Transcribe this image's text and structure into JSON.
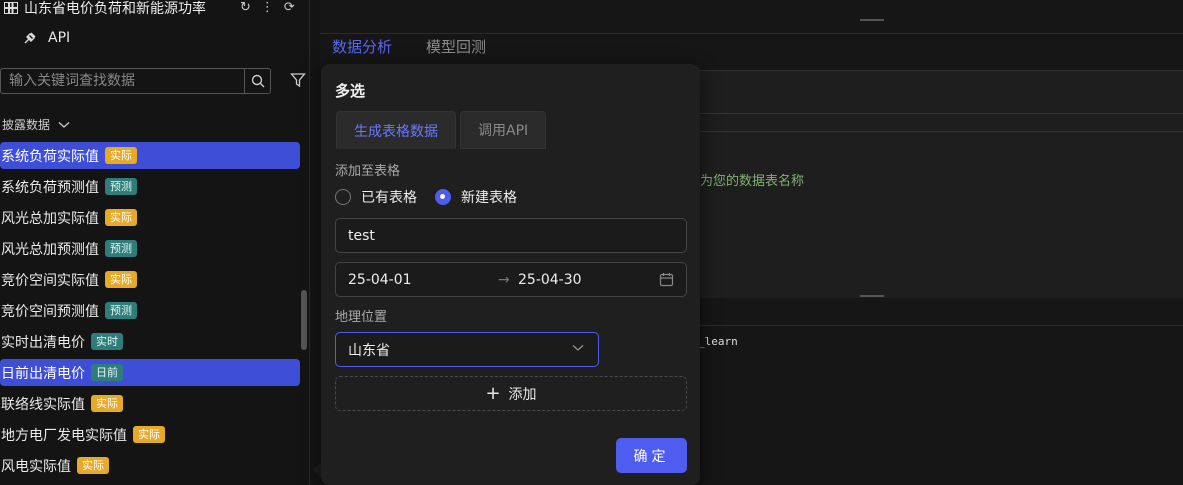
{
  "sidebar": {
    "title": "山东省电价负荷和新能源功率",
    "api_label": "API",
    "search": {
      "placeholder": "输入关键词查找数据",
      "value": ""
    },
    "section": "披露数据",
    "items": [
      {
        "label": "系统负荷实际值",
        "tag": "实际",
        "tag_type": "real",
        "active": true
      },
      {
        "label": "系统负荷预测值",
        "tag": "预测",
        "tag_type": "pred",
        "active": false
      },
      {
        "label": "风光总加实际值",
        "tag": "实际",
        "tag_type": "real",
        "active": false
      },
      {
        "label": "风光总加预测值",
        "tag": "预测",
        "tag_type": "pred",
        "active": false
      },
      {
        "label": "竞价空间实际值",
        "tag": "实际",
        "tag_type": "real",
        "active": false
      },
      {
        "label": "竞价空间预测值",
        "tag": "预测",
        "tag_type": "pred",
        "active": false
      },
      {
        "label": "实时出清电价",
        "tag": "实时",
        "tag_type": "rt",
        "active": false
      },
      {
        "label": "日前出清电价",
        "tag": "日前",
        "tag_type": "day",
        "active": true
      },
      {
        "label": "联络线实际值",
        "tag": "实际",
        "tag_type": "real",
        "active": false
      },
      {
        "label": "地方电厂发电实际值",
        "tag": "实际",
        "tag_type": "real",
        "active": false
      },
      {
        "label": "风电实际值",
        "tag": "实际",
        "tag_type": "real",
        "active": false
      }
    ]
  },
  "main": {
    "tabs": [
      "数据分析",
      "模型回测"
    ],
    "hint": "为您的数据表名称",
    "code_snippet": "_learn"
  },
  "popover": {
    "title": "多选",
    "tabs": [
      "生成表格数据",
      "调用API"
    ],
    "add_to_label": "添加至表格",
    "radio_existing": "已有表格",
    "radio_new": "新建表格",
    "table_name": "test",
    "date_start": "25-04-01",
    "date_end": "25-04-30",
    "geo_label": "地理位置",
    "geo_value": "山东省",
    "add_label": "添加",
    "ok_label": "确定"
  },
  "colors": {
    "accent": "#4e5cf0",
    "tag_real": "#e7a928",
    "tag_pred": "#2f7d7a"
  }
}
